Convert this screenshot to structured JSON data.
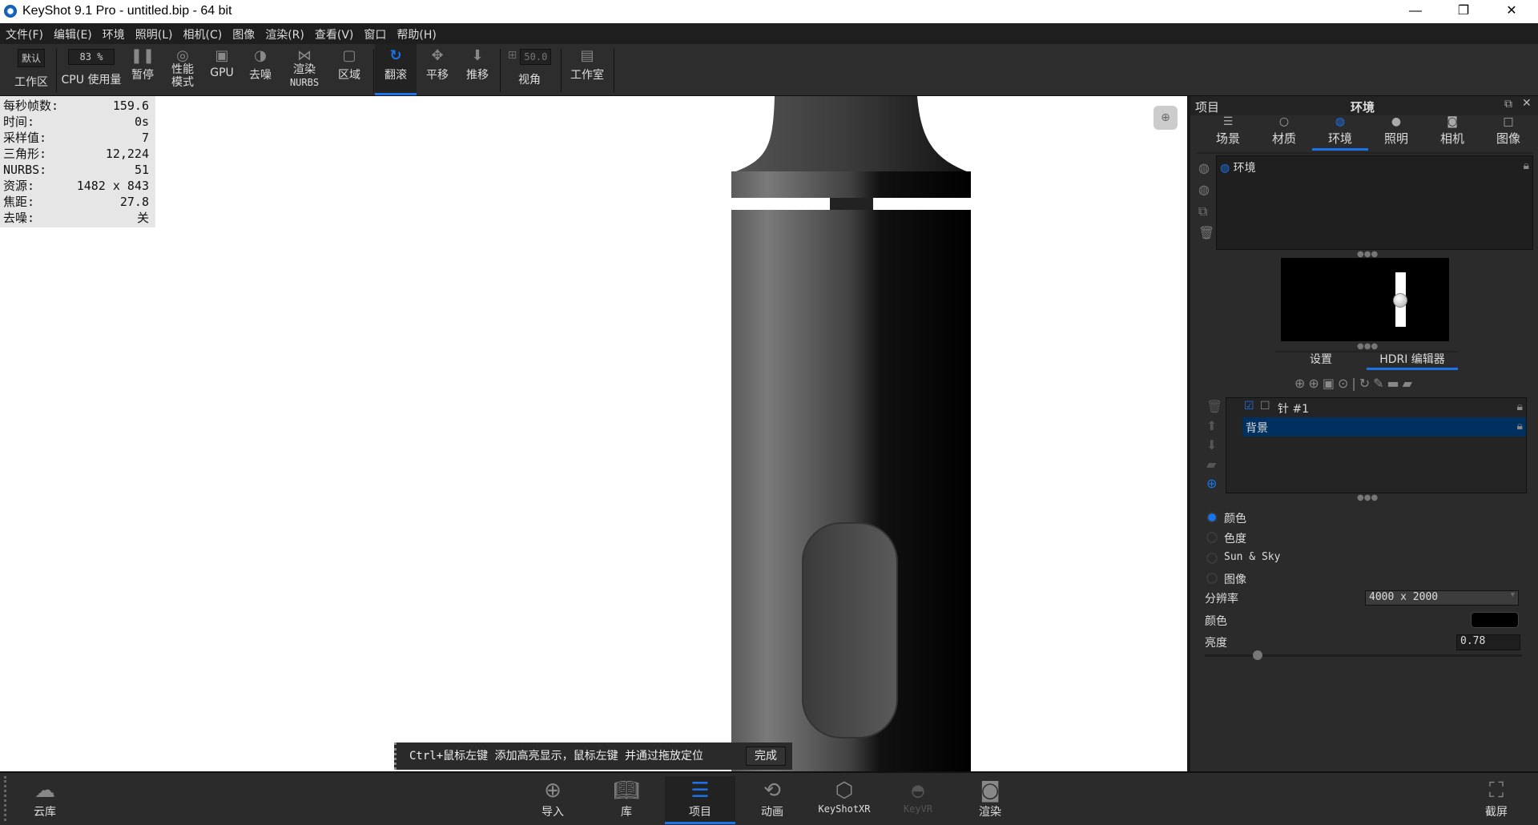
{
  "window": {
    "title": "KeyShot 9.1 Pro  - untitled.bip  - 64 bit",
    "minimize": "—",
    "maximize": "❐",
    "close": "✕"
  },
  "menu": [
    "文件(F)",
    "编辑(E)",
    "环境",
    "照明(L)",
    "相机(C)",
    "图像",
    "渲染(R)",
    "查看(V)",
    "窗口",
    "帮助(H)"
  ],
  "toolbar": {
    "workspace_value": "默认",
    "workspace_label": "工作区",
    "cpu_value": "83 %",
    "cpu_label": "CPU 使用量",
    "pause": "暂停",
    "perf_mode": "性能\n模式",
    "gpu": "GPU",
    "denoise": "去噪",
    "render_nurbs_1": "渲染",
    "render_nurbs_2": "NURBS",
    "region": "区域",
    "tumble": "翻滚",
    "pan": "平移",
    "dolly": "推移",
    "fov_value": "50.0",
    "fov_label": "视角",
    "studio": "工作室"
  },
  "stats": [
    {
      "k": "每秒帧数:",
      "v": "159.6"
    },
    {
      "k": "时间:",
      "v": "0s"
    },
    {
      "k": "采样值:",
      "v": "7"
    },
    {
      "k": "三角形:",
      "v": "12,224"
    },
    {
      "k": "NURBS:",
      "v": "51"
    },
    {
      "k": "资源:",
      "v": "1482 x 843"
    },
    {
      "k": "焦距:",
      "v": "27.8"
    },
    {
      "k": "去噪:",
      "v": "关"
    }
  ],
  "hint": {
    "text": "Ctrl+鼠标左键 添加高亮显示，鼠标左键 并通过拖放定位",
    "done": "完成"
  },
  "panel": {
    "title_left": "项目",
    "title": "环境",
    "tabs": [
      "场景",
      "材质",
      "环境",
      "照明",
      "相机",
      "图像"
    ],
    "active_tab": 2,
    "env_item": "环境",
    "subtabs": [
      "设置",
      "HDRI 编辑器"
    ],
    "active_subtab": 1,
    "layers": [
      {
        "name": "针 #1",
        "checked": true
      },
      {
        "name": "背景",
        "selected": true
      }
    ],
    "bg_options": [
      "颜色",
      "色度",
      "Sun & Sky",
      "图像"
    ],
    "bg_selected": 0,
    "resolution_label": "分辨率",
    "resolution_value": "4000 x 2000",
    "color_label": "颜色",
    "color_value": "#000000",
    "brightness_label": "亮度",
    "brightness_value": "0.78",
    "accent": "#1a73e8"
  },
  "bottombar": {
    "cloud": "云库",
    "import": "导入",
    "library": "库",
    "project": "项目",
    "animation": "动画",
    "keyshotxr": "KeyShotXR",
    "keyvr": "KeyVR",
    "render": "渲染",
    "screenshot": "截屏",
    "active": "项目"
  }
}
